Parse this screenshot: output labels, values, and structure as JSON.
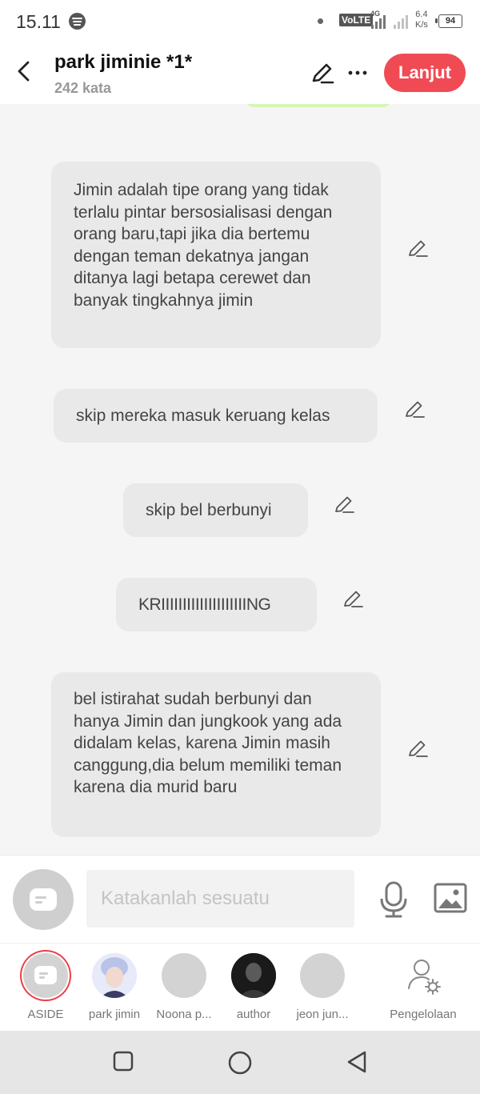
{
  "status_bar": {
    "time": "15.11",
    "volte": "VoLTE",
    "network": "4G",
    "speed_value": "6.4",
    "speed_unit": "K/s",
    "battery": "94"
  },
  "header": {
    "title": "park jiminie *1*",
    "subtitle": "242 kata",
    "continue_label": "Lanjut",
    "accent_color": "#f04b55"
  },
  "messages": [
    {
      "text": "Jimin adalah tipe orang yang tidak terlalu pintar bersosialisasi dengan orang baru,tapi jika dia bertemu dengan teman dekatnya jangan ditanya lagi betapa cerewet dan banyak tingkahnya jimin"
    },
    {
      "text": "skip mereka masuk keruang kelas"
    },
    {
      "text": "skip bel berbunyi"
    },
    {
      "text": "KRIIIIIIIIIIIIIIIIIIIING"
    },
    {
      "text": "bel istirahat sudah berbunyi dan hanya Jimin dan jungkook yang ada didalam kelas, karena Jimin masih canggung,dia belum memiliki teman karena dia murid baru"
    }
  ],
  "input": {
    "placeholder": "Katakanlah sesuatu"
  },
  "characters": [
    {
      "label": "ASIDE"
    },
    {
      "label": "park jimin"
    },
    {
      "label": "Noona p..."
    },
    {
      "label": "author"
    },
    {
      "label": "jeon jun..."
    },
    {
      "label": "Pengelolaan"
    }
  ],
  "icons": {
    "back": "chevron-left-icon",
    "edit": "pencil-icon",
    "more": "more-horizontal-icon",
    "mic": "microphone-icon",
    "image": "image-icon",
    "settings": "user-settings-icon"
  }
}
